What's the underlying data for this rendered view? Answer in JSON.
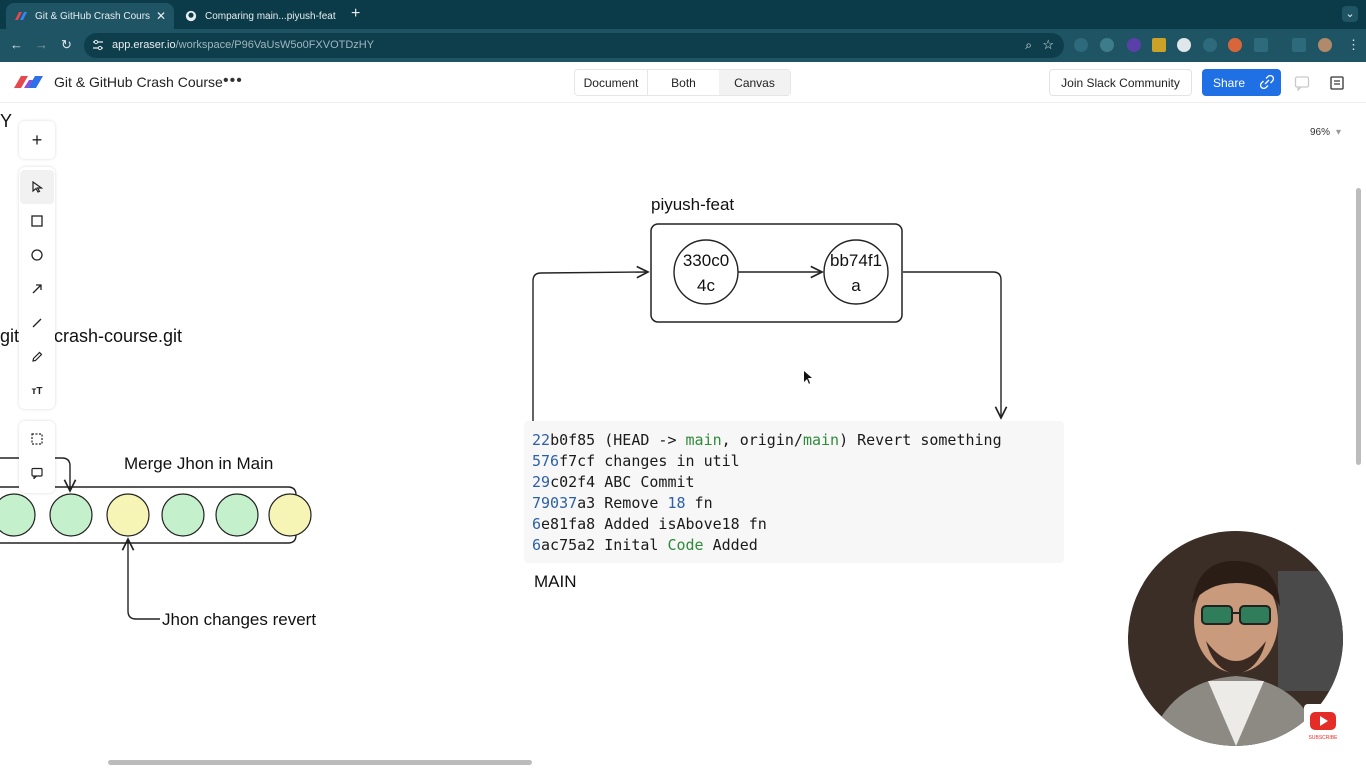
{
  "browser": {
    "tabs": [
      {
        "title": "Git & GitHub Crash Course —",
        "active": true
      },
      {
        "title": "Comparing main...piyush-feat",
        "active": false
      }
    ],
    "url_host": "app.eraser.io",
    "url_path": "/workspace/P96VaUsW5o0FXVOTDzHY"
  },
  "app": {
    "title": "Git & GitHub Crash Course",
    "view_tabs": [
      "Document",
      "Both",
      "Canvas"
    ],
    "active_view": "Canvas",
    "slack_label": "Join Slack Community",
    "share_label": "Share",
    "zoom": "96%"
  },
  "canvas": {
    "partial_top": "Y",
    "repo_text_left": "git",
    "repo_text_right": "crash-course.git",
    "branch_label": "piyush-feat",
    "commit_a_line1": "330c0",
    "commit_a_line2": "4c",
    "commit_b_line1": "bb74f1",
    "commit_b_line2": "a",
    "merge_label": "Merge Jhon in Main",
    "revert_label": "Jhon changes revert",
    "main_label": "MAIN",
    "git_log": [
      {
        "hash_hl": "22",
        "hash_rest": "b0f85",
        "pre": " (HEAD -> ",
        "main1": "main",
        "mid": ", origin/",
        "main2": "main",
        "post": ") Revert something"
      },
      {
        "hash_hl": "576",
        "hash_rest": "f7cf",
        "msg": " changes in util"
      },
      {
        "hash_hl": "29",
        "hash_rest": "c02f4",
        "msg": " ABC Commit"
      },
      {
        "hash_hl": "79037",
        "hash_rest": "a3",
        "msg_pre": " Remove ",
        "num": "18",
        "msg_post": " fn"
      },
      {
        "hash_hl": "6",
        "hash_rest": "e81fa8",
        "msg": " Added isAbove18 fn"
      },
      {
        "hash_hl": "6",
        "hash_rest": "ac75a2",
        "msg_pre": " Inital ",
        "code": "Code",
        "msg_post": " Added"
      }
    ]
  },
  "colors": {
    "chrome_dark": "#0b3b48",
    "chrome_mid": "#1e5463",
    "share_blue": "#1f6fe5",
    "node_green": "#c4f0cc",
    "node_yellow": "#f7f5b5"
  }
}
